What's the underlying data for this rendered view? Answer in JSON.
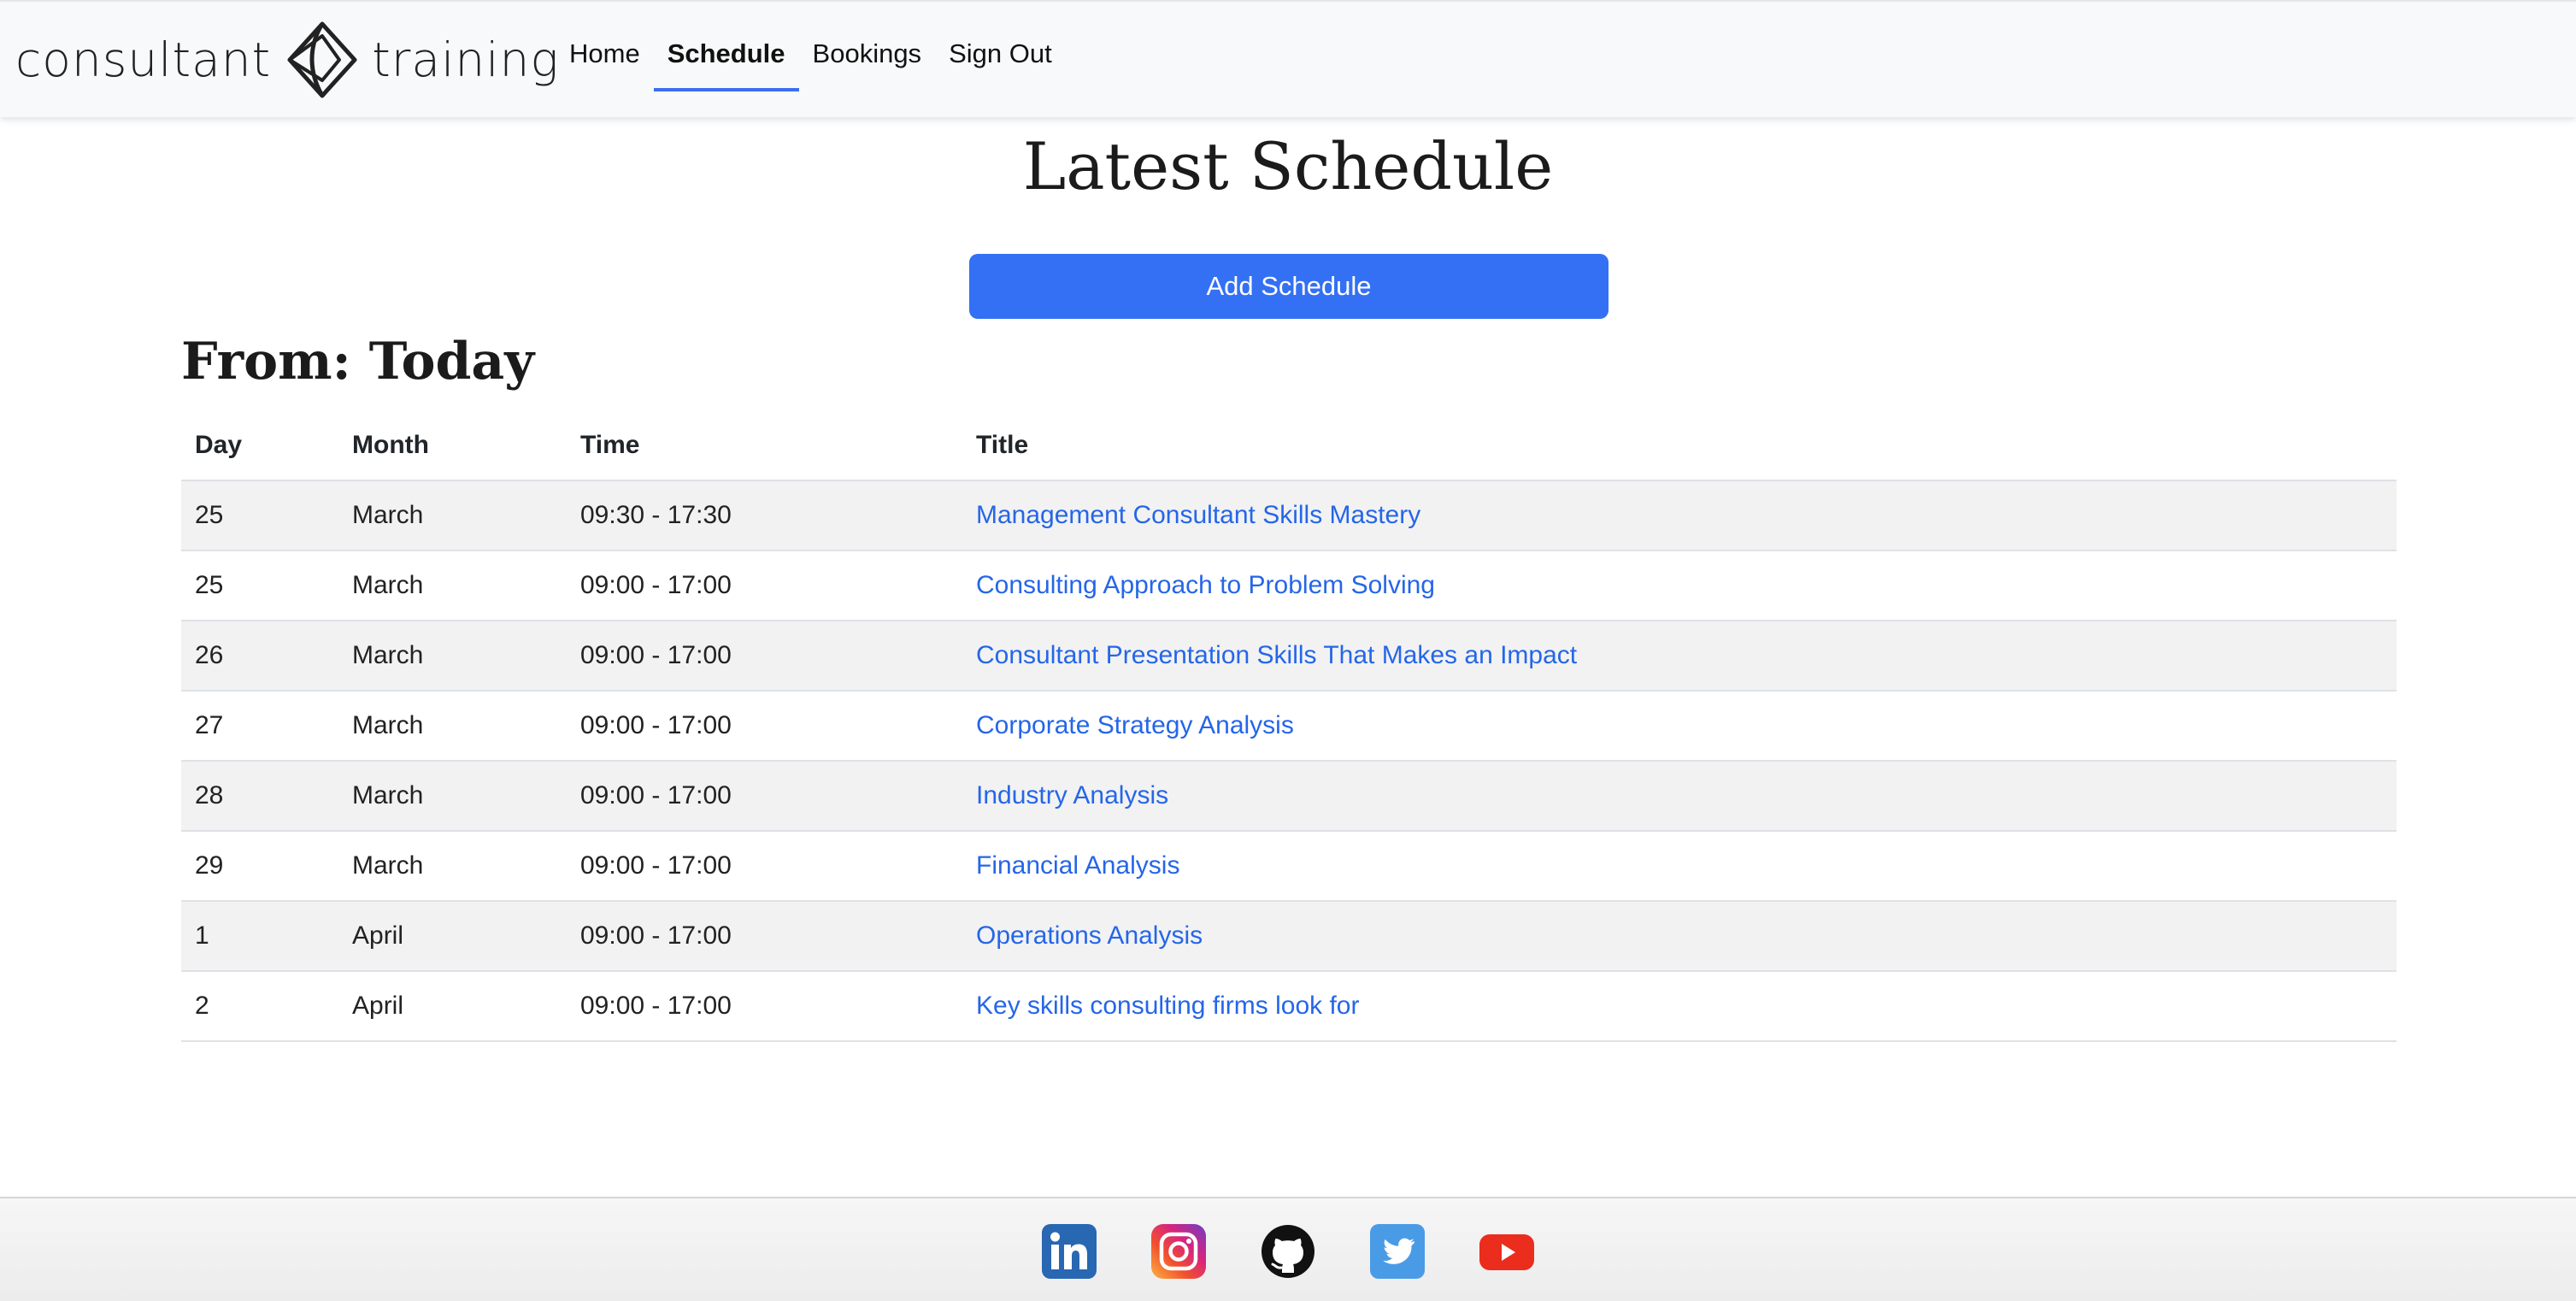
{
  "brand": {
    "left_word": "consultant",
    "right_word": "training"
  },
  "nav": {
    "items": [
      {
        "label": "Home"
      },
      {
        "label": "Schedule"
      },
      {
        "label": "Bookings"
      },
      {
        "label": "Sign Out"
      }
    ],
    "active": "Schedule"
  },
  "main": {
    "title": "Latest Schedule",
    "add_button_label": "Add Schedule",
    "from_label": "From: Today"
  },
  "table": {
    "headers": [
      "Day",
      "Month",
      "Time",
      "Title"
    ],
    "rows": [
      {
        "day": "25",
        "month": "March",
        "time": "09:30 - 17:30",
        "title": "Management Consultant Skills Mastery"
      },
      {
        "day": "25",
        "month": "March",
        "time": "09:00 - 17:00",
        "title": "Consulting Approach to Problem Solving"
      },
      {
        "day": "26",
        "month": "March",
        "time": "09:00 - 17:00",
        "title": "Consultant Presentation Skills That Makes an Impact"
      },
      {
        "day": "27",
        "month": "March",
        "time": "09:00 - 17:00",
        "title": "Corporate Strategy Analysis"
      },
      {
        "day": "28",
        "month": "March",
        "time": "09:00 - 17:00",
        "title": "Industry Analysis"
      },
      {
        "day": "29",
        "month": "March",
        "time": "09:00 - 17:00",
        "title": "Financial Analysis"
      },
      {
        "day": "1",
        "month": "April",
        "time": "09:00 - 17:00",
        "title": "Operations Analysis"
      },
      {
        "day": "2",
        "month": "April",
        "time": "09:00 - 17:00",
        "title": "Key skills consulting firms look for"
      }
    ]
  },
  "footer": {
    "social": [
      "linkedin-icon",
      "instagram-icon",
      "github-icon",
      "twitter-icon",
      "youtube-icon"
    ]
  },
  "colors": {
    "accent": "#3470f4",
    "link": "#2566e8",
    "stripe": "#f2f2f2"
  }
}
